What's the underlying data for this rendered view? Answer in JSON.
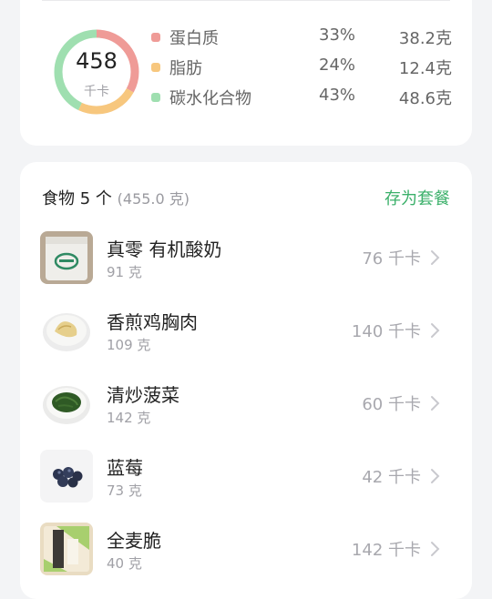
{
  "summary": {
    "calories_value": "458",
    "calories_unit": "千卡",
    "macros": [
      {
        "name": "蛋白质",
        "percent": "33%",
        "amount": "38.2克",
        "color": "#ef9b97",
        "fraction": 0.33
      },
      {
        "name": "脂肪",
        "percent": "24%",
        "amount": "12.4克",
        "color": "#f7c77e",
        "fraction": 0.24
      },
      {
        "name": "碳水化合物",
        "percent": "43%",
        "amount": "48.6克",
        "color": "#9fdfb0",
        "fraction": 0.43
      }
    ]
  },
  "foods": {
    "title": "食物 5 个",
    "total_weight": "(455.0 克)",
    "save_meal_label": "存为套餐",
    "items": [
      {
        "name": "真零 有机酸奶",
        "weight": "91 克",
        "kcal": "76 千卡",
        "icon": "yogurt-cup-icon"
      },
      {
        "name": "香煎鸡胸肉",
        "weight": "109 克",
        "kcal": "140 千卡",
        "icon": "chicken-breast-icon"
      },
      {
        "name": "清炒菠菜",
        "weight": "142 克",
        "kcal": "60 千卡",
        "icon": "spinach-dish-icon"
      },
      {
        "name": "蓝莓",
        "weight": "73 克",
        "kcal": "42 千卡",
        "icon": "blueberry-icon"
      },
      {
        "name": "全麦脆",
        "weight": "40 克",
        "kcal": "142 千卡",
        "icon": "whole-wheat-crisp-icon"
      }
    ]
  }
}
